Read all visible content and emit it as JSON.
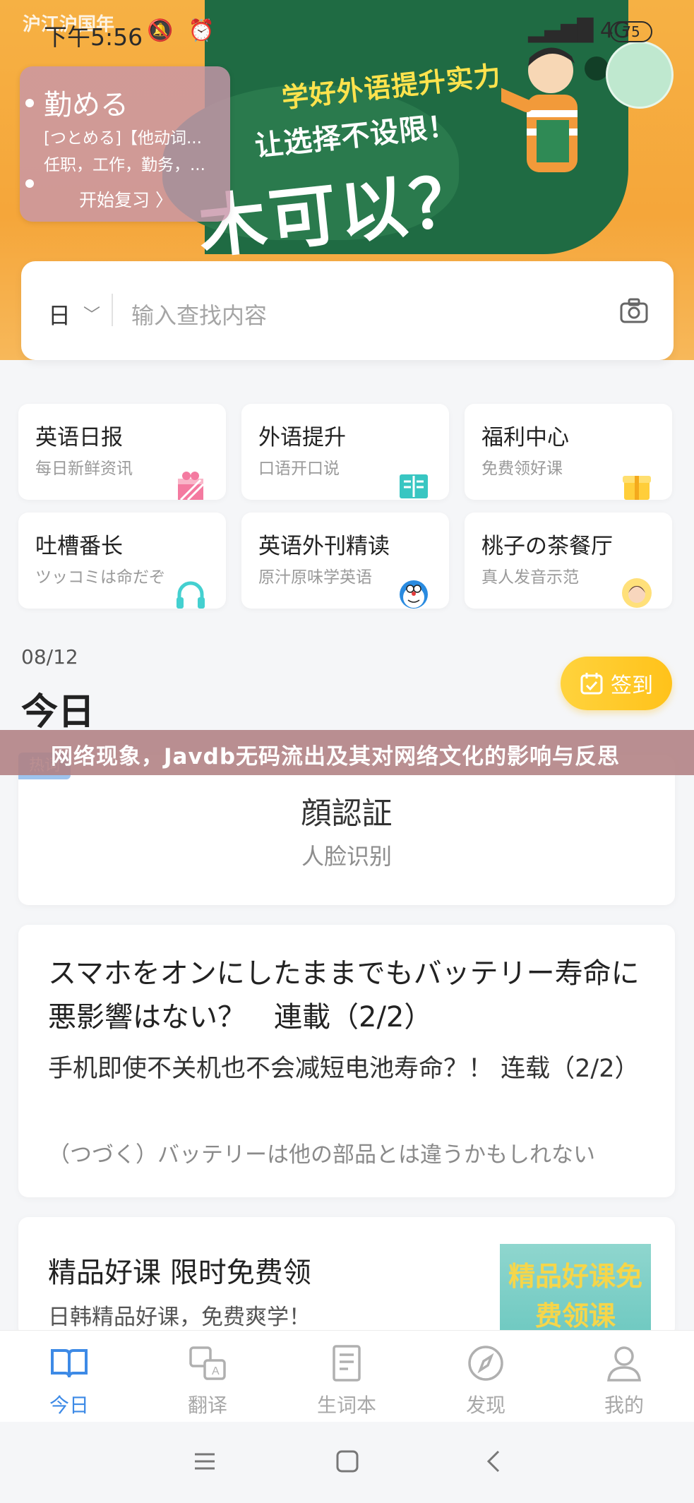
{
  "status": {
    "carrier": "沪江沪国年",
    "time": "下午5:56",
    "alarm_icons": "🔕 ⏰",
    "network": "4G",
    "battery": "75"
  },
  "banner": {
    "line1": "学好外语提升实力",
    "line2": "让选择不设限！",
    "big_text": "木可以？",
    "icon": "illustration-student"
  },
  "word_card": {
    "headword": "勤める",
    "line1": "[つとめる]【他动词...",
    "line2": "任职，工作，勤务，...",
    "review_button": "开始复习 〉"
  },
  "search": {
    "language": "日",
    "placeholder": "输入查找内容",
    "camera_icon": "camera-icon"
  },
  "tiles": [
    {
      "title": "英语日报",
      "subtitle": "每日新鲜资讯",
      "icon": "gift-icon"
    },
    {
      "title": "外语提升",
      "subtitle": "口语开口说",
      "icon": "book-icon"
    },
    {
      "title": "福利中心",
      "subtitle": "免费领好课",
      "icon": "giftbox-icon"
    },
    {
      "title": "吐槽番长",
      "subtitle": "ツッコミは命だぞ",
      "icon": "headphone-icon"
    },
    {
      "title": "英语外刊精读",
      "subtitle": "原汁原味学英语",
      "icon": "doraemon-icon"
    },
    {
      "title": "桃子の茶餐厅",
      "subtitle": "真人发音示范",
      "icon": "avatar-icon"
    }
  ],
  "today": {
    "date": "08/12",
    "heading": "今日",
    "sign_label": "签到"
  },
  "overlay": {
    "text": "网络现象，Javdb无码流出及其对网络文化的影响与反思",
    "hot_tag": "热词"
  },
  "cards": {
    "word_of_day": {
      "title": "顔認証",
      "subtitle": "人脸识别"
    },
    "article": {
      "jp_title": "スマホをオンにしたままでもバッテリー寿命に悪影響はない？　連載（2/2）",
      "cn_title": "手机即使不关机也不会减短电池寿命？！ 连载（2/2）",
      "note": "（つづく）バッテリーは他の部品とは違うかもしれない"
    },
    "course": {
      "title": "精品好课 限时免费领",
      "subtitle": "日韩精品好课，免费爽学！",
      "image_text": "精品好课免费领课"
    }
  },
  "bottom_nav": [
    {
      "label": "今日",
      "icon": "book-open-icon",
      "active": true
    },
    {
      "label": "翻译",
      "icon": "translate-icon",
      "active": false
    },
    {
      "label": "生词本",
      "icon": "notebook-icon",
      "active": false
    },
    {
      "label": "发现",
      "icon": "compass-icon",
      "active": false
    },
    {
      "label": "我的",
      "icon": "user-icon",
      "active": false
    }
  ],
  "colors": {
    "accent": "#3d8ae6",
    "banner_orange": "#f5a63a",
    "sign_yellow": "#ffc21a"
  }
}
